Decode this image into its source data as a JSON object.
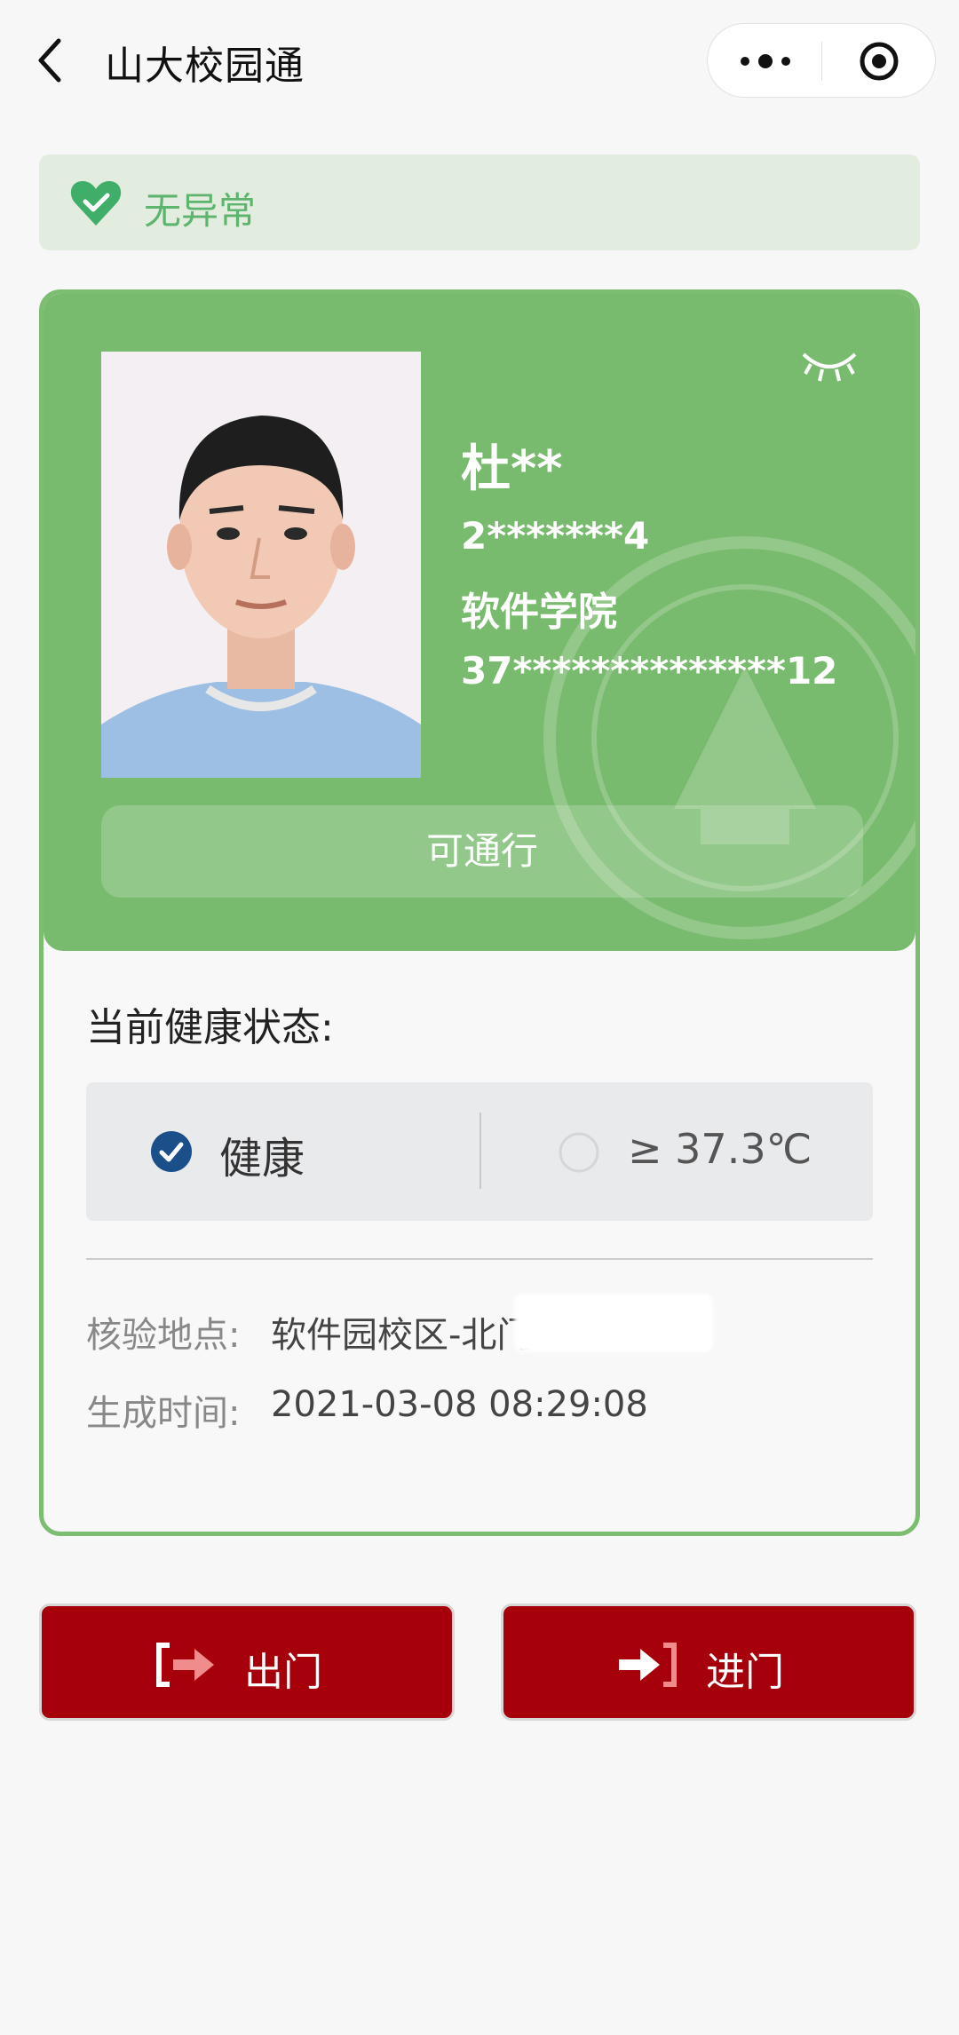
{
  "header": {
    "title": "山大校园通",
    "icons": [
      "back-arrow-icon",
      "more-dots-icon",
      "target-icon"
    ]
  },
  "status": {
    "text": "无异常",
    "icon": "heart-check-icon",
    "color": "#5db46d"
  },
  "card": {
    "name": "杜**",
    "student_id": "2*******4",
    "college": "软件学院",
    "id_number": "37**************12",
    "pass_label": "可通行",
    "icons": [
      "eye-closed-icon",
      "seal-watermark"
    ]
  },
  "health": {
    "label": "当前健康状态:",
    "options": [
      {
        "label": "健康",
        "selected": true
      },
      {
        "label": "≥ 37.3℃",
        "selected": false
      }
    ]
  },
  "info": {
    "location_label": "核验地点:",
    "location_value": "软件园校区-北门",
    "time_label": "生成时间:",
    "time_value": "2021-03-08 08:29:08"
  },
  "buttons": {
    "exit_label": "出门",
    "enter_label": "进门"
  },
  "colors": {
    "card_green": "#79bb6e",
    "border_green": "#7dbd72",
    "button_red": "#a6000a",
    "check_blue": "#1b4f8a"
  }
}
